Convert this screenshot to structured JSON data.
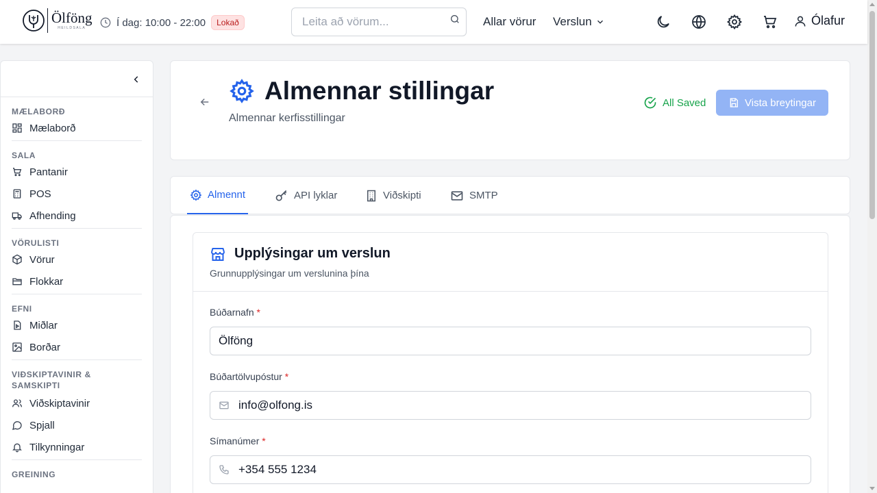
{
  "header": {
    "logo_text": "Ölföng",
    "logo_sub": "HEILDSALA",
    "hours_text": "Í dag: 10:00 - 22:00",
    "status_badge": "Lokað",
    "search_placeholder": "Leita að vörum...",
    "nav_all_products": "Allar vörur",
    "nav_shop": "Verslun",
    "user_name": "Ólafur"
  },
  "sidebar": {
    "sections": [
      {
        "title": "MÆLABORÐ",
        "items": [
          {
            "label": "Mælaborð",
            "icon": "dashboard-icon"
          }
        ]
      },
      {
        "title": "SALA",
        "items": [
          {
            "label": "Pantanir",
            "icon": "cart-icon"
          },
          {
            "label": "POS",
            "icon": "calculator-icon"
          },
          {
            "label": "Afhending",
            "icon": "truck-icon"
          }
        ]
      },
      {
        "title": "VÖRULISTI",
        "items": [
          {
            "label": "Vörur",
            "icon": "box-icon"
          },
          {
            "label": "Flokkar",
            "icon": "folder-icon"
          }
        ]
      },
      {
        "title": "EFNI",
        "items": [
          {
            "label": "Miðlar",
            "icon": "media-icon"
          },
          {
            "label": "Borðar",
            "icon": "image-icon"
          }
        ]
      },
      {
        "title": "VIÐSKIPTAVINIR & SAMSKIPTI",
        "items": [
          {
            "label": "Viðskiptavinir",
            "icon": "users-icon"
          },
          {
            "label": "Spjall",
            "icon": "chat-icon"
          },
          {
            "label": "Tilkynningar",
            "icon": "bell-icon"
          }
        ]
      },
      {
        "title": "GREINING",
        "items": []
      }
    ]
  },
  "page": {
    "title": "Almennar stillingar",
    "subtitle": "Almennar kerfisstillingar",
    "saved_status": "All Saved",
    "save_button": "Vista breytingar"
  },
  "tabs": [
    {
      "label": "Almennt",
      "icon": "gear-icon",
      "active": true
    },
    {
      "label": "API lyklar",
      "icon": "key-icon",
      "active": false
    },
    {
      "label": "Viðskipti",
      "icon": "building-icon",
      "active": false
    },
    {
      "label": "SMTP",
      "icon": "mail-icon",
      "active": false
    }
  ],
  "store_info": {
    "title": "Upplýsingar um verslun",
    "subtitle": "Grunnupplýsingar um verslunina þína",
    "fields": [
      {
        "label": "Búðarnafn",
        "required_mark": "*",
        "value": "Ölföng",
        "icon": ""
      },
      {
        "label": "Búðartölvupóstur",
        "required_mark": "*",
        "value": "info@olfong.is",
        "icon": "mail-icon"
      },
      {
        "label": "Símanúmer",
        "required_mark": "*",
        "value": "+354 555 1234",
        "icon": "phone-icon"
      }
    ]
  },
  "colors": {
    "accent": "#2563eb",
    "save_button_bg": "#93b4f5",
    "success": "#16a34a",
    "badge_bg": "#fee2e2",
    "badge_text": "#b91c1c",
    "required": "#dc2626"
  }
}
